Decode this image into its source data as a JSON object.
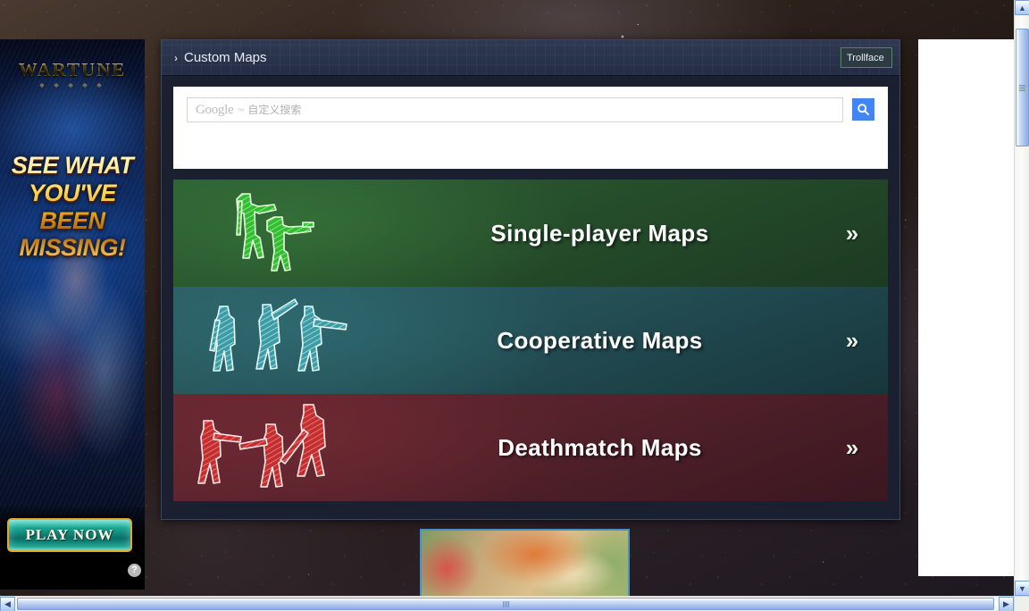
{
  "panel": {
    "breadcrumb_chevron": "›",
    "breadcrumb_title": "Custom Maps",
    "badge_label": "Trollface"
  },
  "search": {
    "placeholder_google": "Google",
    "placeholder_tm": "™",
    "placeholder_cn": "自定义搜索",
    "value": "",
    "button_icon": "search-icon",
    "button_color": "#4285f4"
  },
  "banners": [
    {
      "id": "single-player",
      "title": "Single-player Maps",
      "arrow": "»",
      "theme": "green",
      "accent": "#3fd13f",
      "art_icon": "soldier-figures-green"
    },
    {
      "id": "cooperative",
      "title": "Cooperative Maps",
      "arrow": "»",
      "theme": "teal",
      "accent": "#5fc2c9",
      "art_icon": "soldier-figures-teal"
    },
    {
      "id": "deathmatch",
      "title": "Deathmatch Maps",
      "arrow": "»",
      "theme": "red",
      "accent": "#e03a38",
      "art_icon": "soldier-figures-red"
    }
  ],
  "left_ad": {
    "logo": "WARTUNE",
    "logo_sub": "❖ ❖ ❖ ❖ ❖",
    "headline_lines": [
      "SEE WHAT",
      "YOU'VE",
      "BEEN",
      "MISSING!"
    ],
    "cta_label": "PLAY NOW",
    "info_label": "?"
  },
  "scrollbars": {
    "v_up": "▲",
    "v_down": "▼",
    "h_left": "◀",
    "h_right": "▶"
  }
}
